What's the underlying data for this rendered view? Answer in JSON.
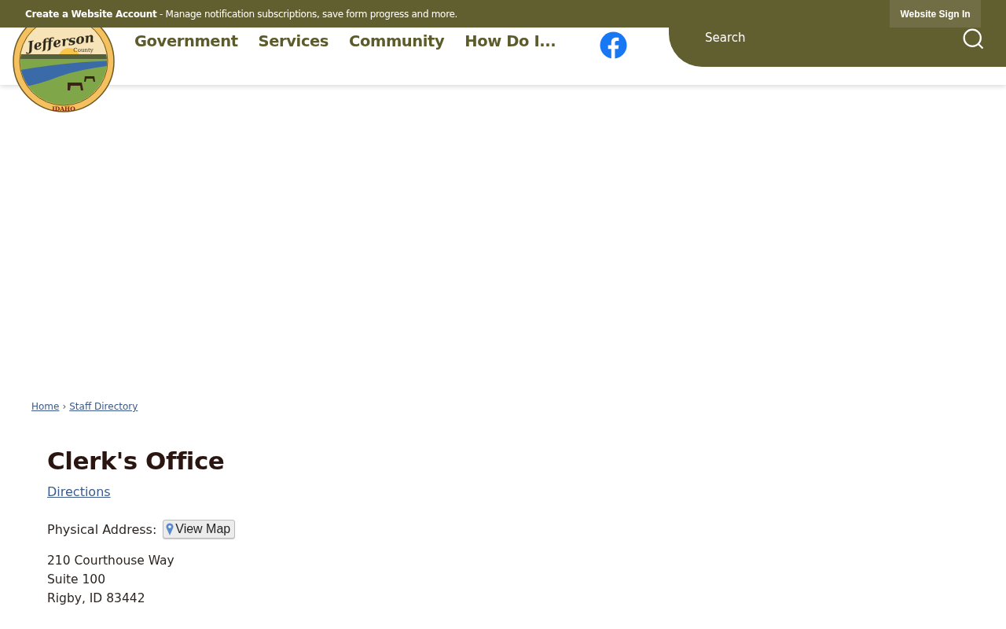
{
  "top_bar": {
    "account_link": "Create a Website Account",
    "account_text": " - Manage notification subscriptions, save form progress and more.",
    "sign_in": "Website Sign In"
  },
  "logo": {
    "name": "Jefferson",
    "county": "County",
    "state": "IDAHO"
  },
  "nav": [
    "Government",
    "Services",
    "Community",
    "How Do I..."
  ],
  "search": {
    "placeholder": "Search"
  },
  "breadcrumb": [
    "Home",
    "Staff Directory"
  ],
  "breadcrumb_separator": "›",
  "title": "Clerk's Office",
  "directions": "Directions",
  "address_label": "Physical Address:",
  "view_map": "View Map",
  "address_lines": [
    "210 Courthouse Way",
    "Suite 100",
    "Rigby, ID 83442"
  ]
}
